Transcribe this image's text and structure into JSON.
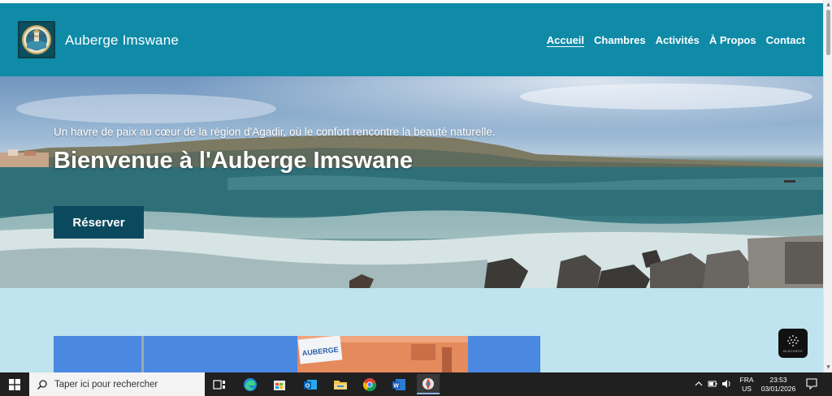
{
  "site": {
    "title": "Auberge Imswane",
    "logo_icon": "auberge-logo-icon"
  },
  "nav": {
    "items": [
      {
        "label": "Accueil",
        "active": true
      },
      {
        "label": "Chambres",
        "active": false
      },
      {
        "label": "Activités",
        "active": false
      },
      {
        "label": "À Propos",
        "active": false
      },
      {
        "label": "Contact",
        "active": false
      }
    ]
  },
  "hero": {
    "tagline": "Un havre de paix au cœur de la région d'Agadir, où le confort rencontre la beauté naturelle.",
    "title": "Bienvenue à l'Auberge Imswane",
    "button_label": "Réserver"
  },
  "content": {
    "image_sign_text": "AUBERGE"
  },
  "blackbox": {
    "label": "BLACKBOX"
  },
  "taskbar": {
    "search_placeholder": "Taper ici pour rechercher",
    "apps": [
      "task-view-icon",
      "edge-icon",
      "store-icon",
      "outlook-icon",
      "file-explorer-icon",
      "chrome-icon",
      "word-icon",
      "paint-app-icon"
    ],
    "lang_line1": "FRA",
    "lang_line2": "US",
    "time": "23:53",
    "date": "03/01/2026"
  },
  "colors": {
    "header_bg": "#0f8aa7",
    "button_bg": "#0b4a5e",
    "section_bg": "#bfe3ef",
    "taskbar_bg": "#202020"
  }
}
